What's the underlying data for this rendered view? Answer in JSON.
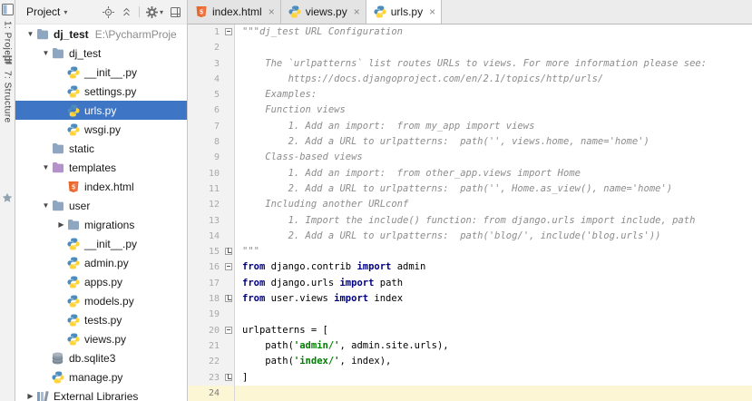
{
  "colors": {
    "selection": "#3E75C4",
    "current_line": "#FCF6D4",
    "keyword": "#000080",
    "string": "#008000",
    "docstring": "#8C8C8C"
  },
  "icons": {
    "close": "×",
    "caret_down": "▾",
    "arrow_expanded": "▼",
    "arrow_collapsed": "▶"
  },
  "left_toolbar": {
    "project_label": "1: Project",
    "structure_label": "7: Structure"
  },
  "project_panel": {
    "title": "Project",
    "tree": [
      {
        "depth": 0,
        "arrow": "down",
        "icon": "folder",
        "label": "dj_test",
        "bold": true,
        "suffix": "E:\\PycharmProje"
      },
      {
        "depth": 1,
        "arrow": "down",
        "icon": "folder",
        "label": "dj_test"
      },
      {
        "depth": 2,
        "arrow": null,
        "icon": "python",
        "label": "__init__.py"
      },
      {
        "depth": 2,
        "arrow": null,
        "icon": "python",
        "label": "settings.py"
      },
      {
        "depth": 2,
        "arrow": null,
        "icon": "python",
        "label": "urls.py",
        "selected": true
      },
      {
        "depth": 2,
        "arrow": null,
        "icon": "python",
        "label": "wsgi.py"
      },
      {
        "depth": 1,
        "arrow": null,
        "icon": "folder",
        "label": "static"
      },
      {
        "depth": 1,
        "arrow": "down",
        "icon": "folder_templates",
        "label": "templates"
      },
      {
        "depth": 2,
        "arrow": null,
        "icon": "html",
        "label": "index.html"
      },
      {
        "depth": 1,
        "arrow": "down",
        "icon": "folder",
        "label": "user"
      },
      {
        "depth": 2,
        "arrow": "right",
        "icon": "folder",
        "label": "migrations"
      },
      {
        "depth": 2,
        "arrow": null,
        "icon": "python",
        "label": "__init__.py"
      },
      {
        "depth": 2,
        "arrow": null,
        "icon": "python",
        "label": "admin.py"
      },
      {
        "depth": 2,
        "arrow": null,
        "icon": "python",
        "label": "apps.py"
      },
      {
        "depth": 2,
        "arrow": null,
        "icon": "python",
        "label": "models.py"
      },
      {
        "depth": 2,
        "arrow": null,
        "icon": "python",
        "label": "tests.py"
      },
      {
        "depth": 2,
        "arrow": null,
        "icon": "python",
        "label": "views.py"
      },
      {
        "depth": 1,
        "arrow": null,
        "icon": "database",
        "label": "db.sqlite3"
      },
      {
        "depth": 1,
        "arrow": null,
        "icon": "python",
        "label": "manage.py"
      },
      {
        "depth": 0,
        "arrow": "right",
        "icon": "libraries",
        "label": "External Libraries"
      }
    ]
  },
  "tabs": [
    {
      "label": "index.html",
      "icon": "html",
      "active": false
    },
    {
      "label": "views.py",
      "icon": "python",
      "active": false
    },
    {
      "label": "urls.py",
      "icon": "python",
      "active": true
    }
  ],
  "editor": {
    "lines": [
      {
        "n": 1,
        "fold": "start",
        "segs": [
          [
            "doc",
            "\"\"\"dj_test URL Configuration"
          ]
        ]
      },
      {
        "n": 2,
        "segs": []
      },
      {
        "n": 3,
        "segs": [
          [
            "doc",
            "    The `urlpatterns` list routes URLs to views. For more information please see:"
          ]
        ]
      },
      {
        "n": 4,
        "segs": [
          [
            "doc",
            "        https://docs.djangoproject.com/en/2.1/topics/http/urls/"
          ]
        ]
      },
      {
        "n": 5,
        "segs": [
          [
            "doc",
            "    Examples:"
          ]
        ]
      },
      {
        "n": 6,
        "segs": [
          [
            "doc",
            "    Function views"
          ]
        ]
      },
      {
        "n": 7,
        "segs": [
          [
            "doc",
            "        1. Add an import:  from my_app import views"
          ]
        ]
      },
      {
        "n": 8,
        "segs": [
          [
            "doc",
            "        2. Add a URL to urlpatterns:  path('', views.home, name='home')"
          ]
        ]
      },
      {
        "n": 9,
        "segs": [
          [
            "doc",
            "    Class-based views"
          ]
        ]
      },
      {
        "n": 10,
        "segs": [
          [
            "doc",
            "        1. Add an import:  from other_app.views import Home"
          ]
        ]
      },
      {
        "n": 11,
        "segs": [
          [
            "doc",
            "        2. Add a URL to urlpatterns:  path('', Home.as_view(), name='home')"
          ]
        ]
      },
      {
        "n": 12,
        "segs": [
          [
            "doc",
            "    Including another URLconf"
          ]
        ]
      },
      {
        "n": 13,
        "segs": [
          [
            "doc",
            "        1. Import the include() function: from django.urls import include, path"
          ]
        ]
      },
      {
        "n": 14,
        "segs": [
          [
            "doc",
            "        2. Add a URL to urlpatterns:  path('blog/', include('blog.urls'))"
          ]
        ]
      },
      {
        "n": 15,
        "fold": "end",
        "segs": [
          [
            "doc",
            "\"\"\""
          ]
        ]
      },
      {
        "n": 16,
        "fold": "start",
        "segs": [
          [
            "kw",
            "from"
          ],
          [
            "pln",
            " django.contrib "
          ],
          [
            "kw",
            "import"
          ],
          [
            "pln",
            " admin"
          ]
        ]
      },
      {
        "n": 17,
        "segs": [
          [
            "kw",
            "from"
          ],
          [
            "pln",
            " django.urls "
          ],
          [
            "kw",
            "import"
          ],
          [
            "pln",
            " path"
          ]
        ]
      },
      {
        "n": 18,
        "fold": "end",
        "segs": [
          [
            "kw",
            "from"
          ],
          [
            "pln",
            " user.views "
          ],
          [
            "kw",
            "import"
          ],
          [
            "pln",
            " index"
          ]
        ]
      },
      {
        "n": 19,
        "segs": []
      },
      {
        "n": 20,
        "fold": "start",
        "segs": [
          [
            "pln",
            "urlpatterns = ["
          ]
        ]
      },
      {
        "n": 21,
        "segs": [
          [
            "pln",
            "    path("
          ],
          [
            "str",
            "'admin/'"
          ],
          [
            "pln",
            ", admin.site.urls),"
          ]
        ]
      },
      {
        "n": 22,
        "segs": [
          [
            "pln",
            "    path("
          ],
          [
            "str",
            "'index/'"
          ],
          [
            "pln",
            ", index),"
          ]
        ]
      },
      {
        "n": 23,
        "fold": "end",
        "segs": [
          [
            "pln",
            "]"
          ]
        ]
      },
      {
        "n": 24,
        "current": true,
        "segs": []
      }
    ]
  }
}
